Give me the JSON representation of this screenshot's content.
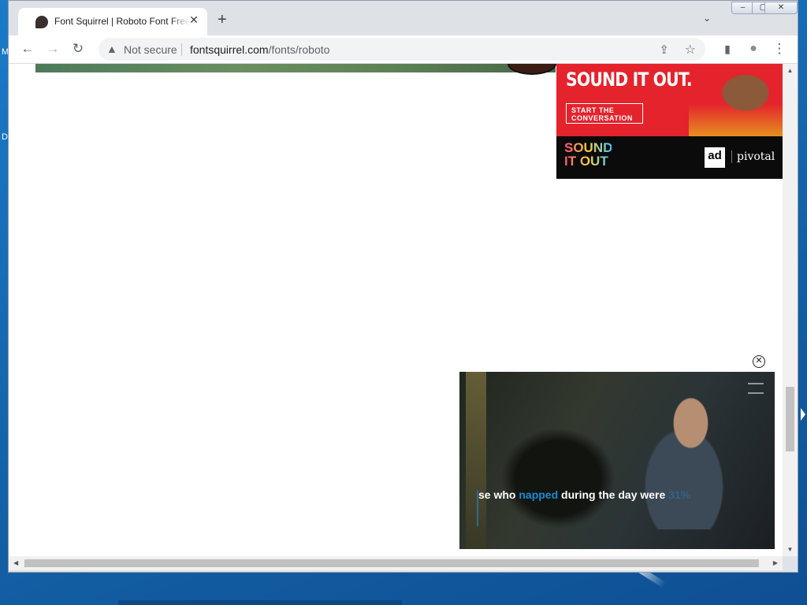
{
  "desktop": {
    "edge_chars": [
      "M",
      "D"
    ]
  },
  "browser": {
    "tab": {
      "title": "Font Squirrel | Roboto Font Free",
      "close": "✕"
    },
    "new_tab": "+",
    "tab_search": "⌄",
    "window_controls": {
      "minimize": "–",
      "maximize": "▢",
      "close": "✕"
    },
    "toolbar": {
      "back": "←",
      "forward": "→",
      "reload": "↻",
      "security_label": "Not secure",
      "url_host": "fontsquirrel.com",
      "url_path": "/fonts/roboto",
      "share": "⇪",
      "bookmark": "☆",
      "side_panel": "▮",
      "profile": "●",
      "menu": "⋮"
    }
  },
  "ad": {
    "headline": "SOUND IT OUT.",
    "cta": "START THE CONVERSATION",
    "logo": "SOUND IT OUT",
    "partner1": "ad",
    "partner2": "pivotal"
  },
  "video": {
    "close": "✕",
    "caption_prefix": "se who ",
    "caption_highlight": "napped",
    "caption_mid": " during the day were ",
    "caption_faded": "31%"
  },
  "colors": {
    "ad_red": "#e4232c",
    "caption_highlight": "#1a8ad4"
  }
}
